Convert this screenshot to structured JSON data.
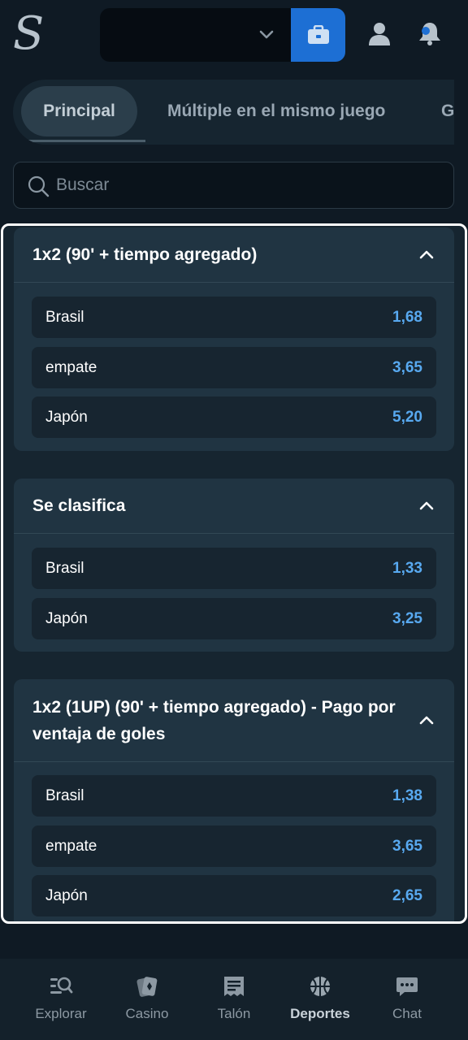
{
  "header": {
    "logo_text": "S",
    "wallet_icon": "wallet-icon",
    "account_icon": "user-icon",
    "notifications_icon": "bell-icon",
    "accent_color": "#1d6fd4"
  },
  "tabs": [
    {
      "label": "Principal",
      "active": true
    },
    {
      "label": "Múltiple en el mismo juego",
      "active": false
    },
    {
      "label": "G",
      "active": false
    }
  ],
  "search": {
    "placeholder": "Buscar"
  },
  "markets": [
    {
      "title": "1x2 (90' + tiempo agregado)",
      "outcomes": [
        {
          "name": "Brasil",
          "odds": "1,68"
        },
        {
          "name": "empate",
          "odds": "3,65"
        },
        {
          "name": "Japón",
          "odds": "5,20"
        }
      ]
    },
    {
      "title": "Se clasifica",
      "outcomes": [
        {
          "name": "Brasil",
          "odds": "1,33"
        },
        {
          "name": "Japón",
          "odds": "3,25"
        }
      ]
    },
    {
      "title": "1x2 (1UP) (90' + tiempo agregado) - Pago por ventaja de goles",
      "outcomes": [
        {
          "name": "Brasil",
          "odds": "1,38"
        },
        {
          "name": "empate",
          "odds": "3,65"
        },
        {
          "name": "Japón",
          "odds": "2,65"
        }
      ]
    }
  ],
  "bottom_nav": [
    {
      "label": "Explorar",
      "icon": "explore-icon",
      "active": false
    },
    {
      "label": "Casino",
      "icon": "cards-icon",
      "active": false
    },
    {
      "label": "Talón",
      "icon": "betslip-icon",
      "active": false
    },
    {
      "label": "Deportes",
      "icon": "basketball-icon",
      "active": true
    },
    {
      "label": "Chat",
      "icon": "chat-icon",
      "active": false
    }
  ]
}
